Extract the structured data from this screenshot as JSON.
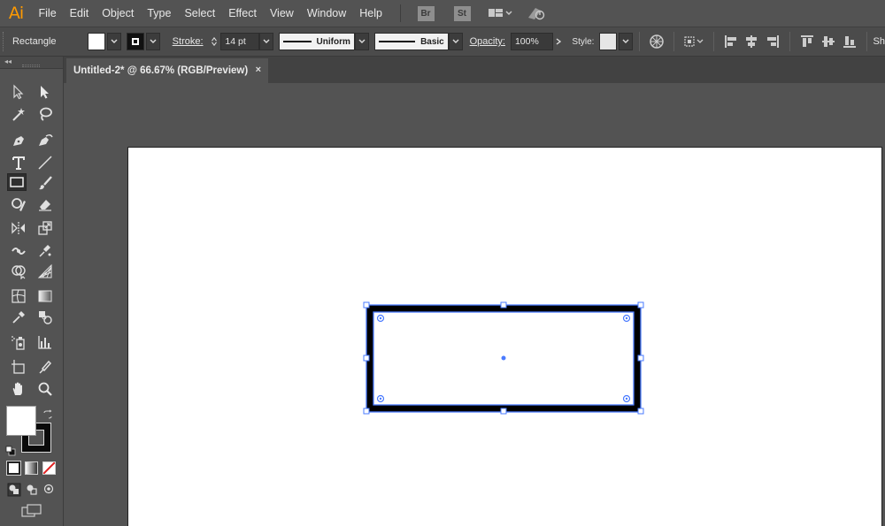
{
  "app": {
    "logo": "Ai"
  },
  "menu": {
    "items": [
      "File",
      "Edit",
      "Object",
      "Type",
      "Select",
      "Effect",
      "View",
      "Window",
      "Help"
    ],
    "bridge_label": "Br",
    "stock_label": "St"
  },
  "control_bar": {
    "tool_name": "Rectangle",
    "fill_color": "#ffffff",
    "stroke_label": "Stroke:",
    "stroke_weight": "14 pt",
    "variable_width_profile": "Uniform",
    "brush_definition": "Basic",
    "opacity_label": "Opacity:",
    "opacity_value": "100%",
    "style_label": "Style:",
    "overflow_label": "Sh"
  },
  "document": {
    "tab_title": "Untitled-2* @ 66.67% (RGB/Preview)",
    "close_glyph": "×"
  },
  "colors": {
    "accent_logo": "#ff9a00",
    "selection": "#4a7bff",
    "artboard": "#ffffff",
    "ui_background": "#535353"
  }
}
